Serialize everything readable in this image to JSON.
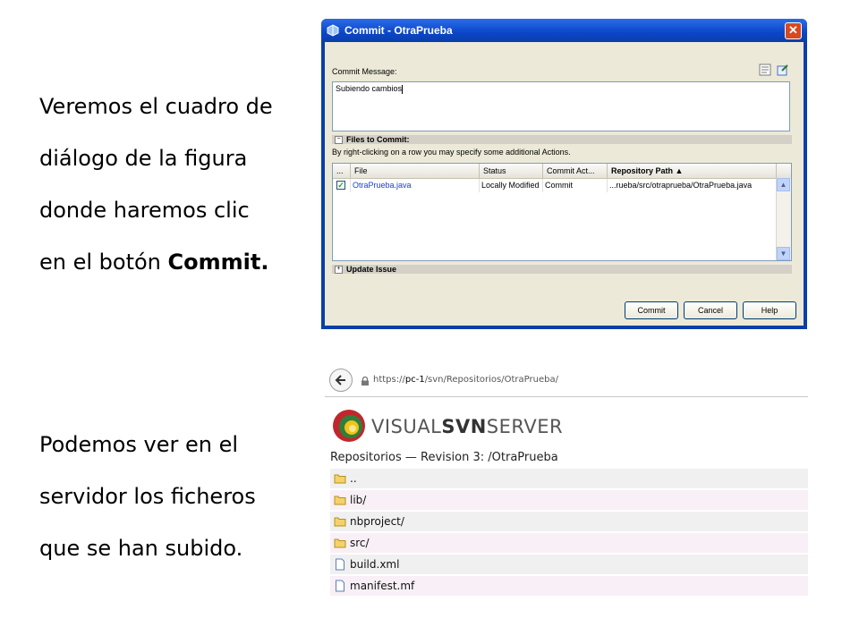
{
  "left_text": {
    "para1": [
      "Veremos el cuadro de",
      "diálogo de la figura",
      "donde haremos clic"
    ],
    "para1_last_prefix": "en el botón ",
    "para1_last_bold": "Commit.",
    "para2": [
      "Podemos ver en el",
      "servidor los ficheros",
      "que se han subido."
    ]
  },
  "dialog": {
    "title": "Commit - OtraPrueba",
    "close_glyph": "✕",
    "commit_message_label": "Commit Message:",
    "commit_message_value": "Subiendo cambios",
    "files_section": "Files to Commit:",
    "hint": "By right-clicking on a row you may specify some additional Actions.",
    "columns": [
      "...",
      "File",
      "Status",
      "Commit Act...",
      "Repository Path ▲"
    ],
    "rows": [
      {
        "file": "OtraPrueba.java",
        "status": "Locally Modified",
        "action": "Commit",
        "path": "...rueba/src/otraprueba/OtraPrueba.java"
      }
    ],
    "update_section": "Update Issue",
    "buttons": {
      "commit": "Commit",
      "cancel": "Cancel",
      "help": "Help"
    }
  },
  "browser": {
    "url_prefix": "https://",
    "url_host": "pc-1",
    "url_path": "/svn/Repositorios/OtraPrueba/",
    "brand_light_1": "VISUAL",
    "brand_bold": "SVN",
    "brand_light_2": "SERVER",
    "revision_title": "Repositorios — Revision 3: /OtraPrueba",
    "entries": [
      {
        "name": "..",
        "icon": "folder-icon"
      },
      {
        "name": "lib/",
        "icon": "folder-icon"
      },
      {
        "name": "nbproject/",
        "icon": "folder-icon"
      },
      {
        "name": "src/",
        "icon": "folder-icon"
      },
      {
        "name": "build.xml",
        "icon": "file-icon"
      },
      {
        "name": "manifest.mf",
        "icon": "file-icon"
      }
    ]
  }
}
